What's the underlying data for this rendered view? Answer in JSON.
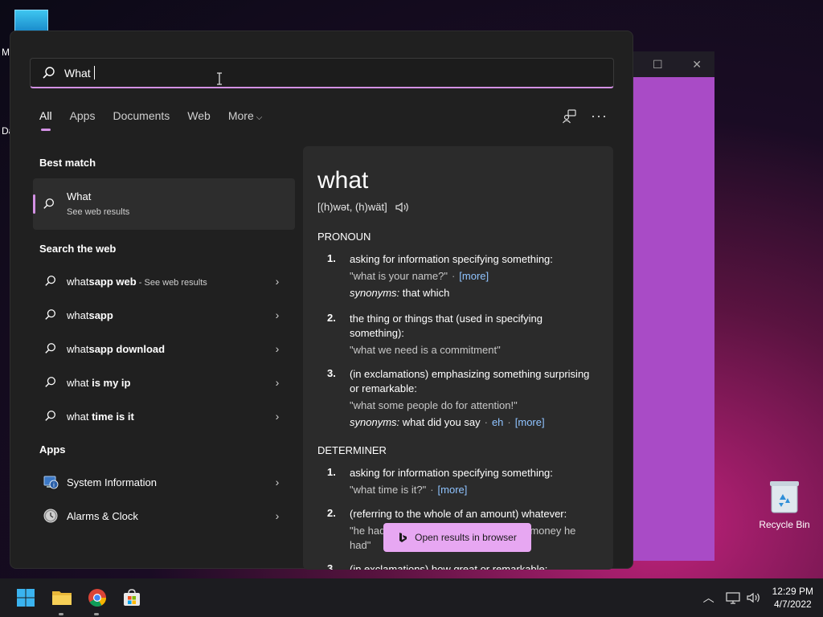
{
  "desktop": {
    "edge_text_1": "M",
    "edge_text_2": "Da",
    "recycle_bin_label": "Recycle Bin",
    "bg_window_color": "#a94bc6"
  },
  "search": {
    "query": "What"
  },
  "tabs": [
    {
      "label": "All",
      "active": true
    },
    {
      "label": "Apps"
    },
    {
      "label": "Documents"
    },
    {
      "label": "Web"
    },
    {
      "label": "More"
    }
  ],
  "sections": {
    "best_match": "Best match",
    "search_web": "Search the web",
    "apps": "Apps"
  },
  "best_match": {
    "title": "What",
    "subtitle": "See web results"
  },
  "web_results": [
    {
      "prefix": "what",
      "bold": "sapp web",
      "suffix": " - See web results"
    },
    {
      "prefix": "what",
      "bold": "sapp",
      "suffix": ""
    },
    {
      "prefix": "what",
      "bold": "sapp download",
      "suffix": ""
    },
    {
      "prefix": "what",
      "bold": " is my ip",
      "suffix": ""
    },
    {
      "prefix": "what",
      "bold": " time is it",
      "suffix": ""
    }
  ],
  "apps": [
    {
      "label": "System Information",
      "icon": "system-information-icon"
    },
    {
      "label": "Alarms & Clock",
      "icon": "alarm-clock-icon"
    }
  ],
  "definition": {
    "word": "what",
    "pronunciation": "[(h)wət, (h)wät]",
    "pos1": "PRONOUN",
    "pron_defs": [
      {
        "num": "1.",
        "text": "asking for information specifying something:",
        "example": "\"what is your name?\"",
        "more": "[more]",
        "syn_label": "synonyms:",
        "syn": "that which"
      },
      {
        "num": "2.",
        "text": "the thing or things that (used in specifying something):",
        "example": "\"what we need is a commitment\""
      },
      {
        "num": "3.",
        "text": "(in exclamations) emphasizing something surprising or remarkable:",
        "example": "\"what some people do for attention!\"",
        "syn_label": "synonyms:",
        "syn": "what did you say",
        "syn2": "eh",
        "more": "[more]"
      }
    ],
    "pos2": "DETERMINER",
    "det_defs": [
      {
        "num": "1.",
        "text": "asking for information specifying something:",
        "example": "\"what time is it?\"",
        "more": "[more]"
      },
      {
        "num": "2.",
        "text": "(referring to the whole of an amount) whatever:",
        "example": "\"he had barely enough food, what little money he had\""
      },
      {
        "num": "3.",
        "text": "(in exclamations) how great or remarkable:"
      }
    ]
  },
  "open_browser": "Open results in browser",
  "taskbar": {
    "time": "12:29 PM",
    "date": "4/7/2022"
  }
}
